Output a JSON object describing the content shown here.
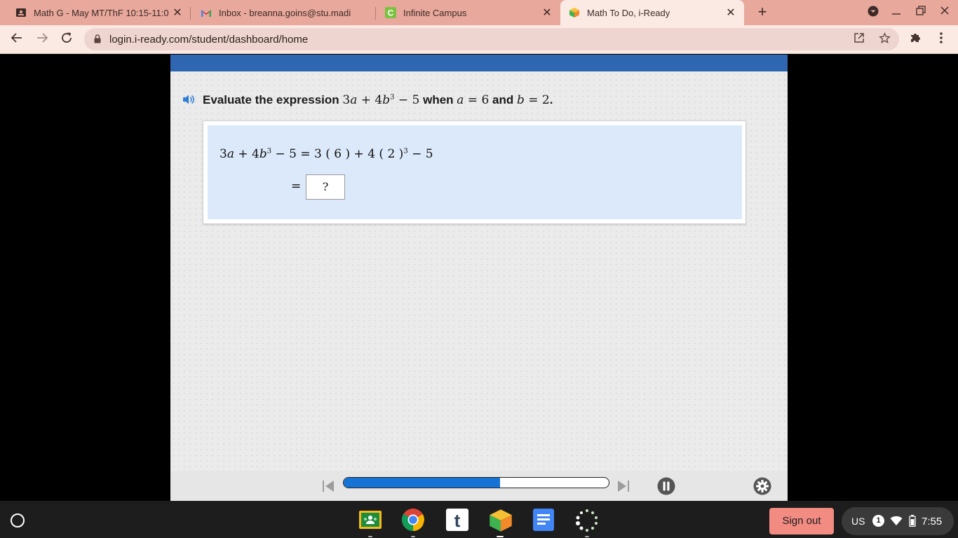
{
  "browser": {
    "tabs": [
      {
        "title": "Math G - May MT/ThF 10:15-11:0",
        "icon": "classroom-icon",
        "active": false
      },
      {
        "title": "Inbox - breanna.goins@stu.madi",
        "icon": "gmail-icon",
        "active": false
      },
      {
        "title": "Infinite Campus",
        "icon": "infinite-campus-icon",
        "active": false
      },
      {
        "title": "Math To Do, i-Ready",
        "icon": "iready-icon",
        "active": true
      }
    ],
    "close_glyph": "✕",
    "new_tab_glyph": "+",
    "url": "login.i-ready.com/student/dashboard/home"
  },
  "lesson": {
    "prompt": {
      "lead": "Evaluate the expression ",
      "expr_pre": "3",
      "expr_var1": "a",
      "expr_mid": " + 4",
      "expr_var2": "b",
      "expr_exp": "3",
      "expr_post": " − 5",
      "when": " when ",
      "var_a": "a",
      "eq_a": " = 6",
      "and": " and ",
      "var_b": "b",
      "eq_b": " = 2",
      "period": "."
    },
    "work": {
      "line1": {
        "lhs_coef": "3",
        "lhs_var1": "a",
        "lhs_plus": " + 4",
        "lhs_var2": "b",
        "lhs_exp": "3",
        "lhs_minus": " − 5",
        "eq": " = ",
        "rhs_a": "3 ( 6 ) + 4 ( 2 )",
        "rhs_exp": "3",
        "rhs_b": " − 5"
      },
      "line2_eq": "=",
      "answer_placeholder": "?"
    },
    "progress": 0.59
  },
  "shelf": {
    "apps": [
      "google-classroom-icon",
      "chrome-icon",
      "tumblr-t-icon",
      "iready-icon",
      "google-docs-icon",
      "loading-dots-icon"
    ],
    "signout_label": "Sign out",
    "tray": {
      "locale": "US",
      "notifications": "1",
      "time": "7:55"
    }
  },
  "colors": {
    "tabstrip": "#e8a89c",
    "toolbar": "#fbe9e4",
    "lesson_bar": "#2f66b1",
    "work_panel": "#dce9fa",
    "progress": "#1673d6",
    "signout": "#f28b82"
  }
}
